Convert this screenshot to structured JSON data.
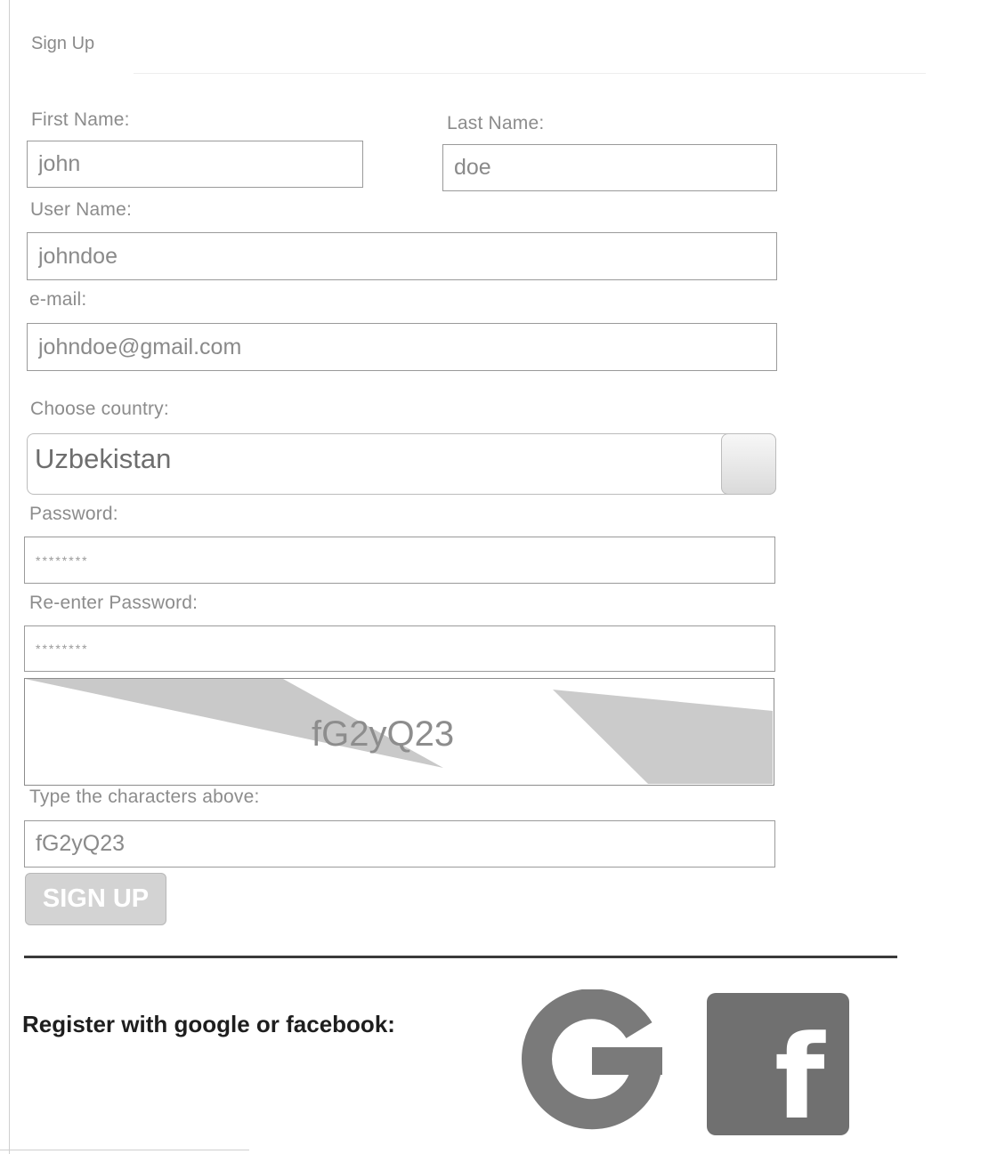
{
  "form": {
    "title": "Sign Up",
    "first_name_label": "First Name:",
    "first_name_value": "john",
    "last_name_label": "Last Name:",
    "last_name_value": "doe",
    "username_label": "User Name:",
    "username_value": "johndoe",
    "email_label": "e-mail:",
    "email_value": "johndoe@gmail.com",
    "country_label": "Choose country:",
    "country_value": "Uzbekistan",
    "password_label": "Password:",
    "password_value": "********",
    "reenter_label": "Re-enter Password:",
    "reenter_value": "********",
    "captcha_text": "fG2yQ23",
    "captcha_prompt": "Type the characters above:",
    "captcha_input_value": "fG2yQ23",
    "signup_label": "SIGN UP"
  },
  "social": {
    "register_text": "Register with google or facebook:",
    "google_icon": "google-g-icon",
    "facebook_icon": "facebook-f-icon",
    "facebook_letter": "f"
  },
  "colors": {
    "button_bg": "#d3d3d3",
    "divider": "#3a3a3a",
    "facebook_bg": "#707070",
    "google_g": "#7a7a7a"
  }
}
